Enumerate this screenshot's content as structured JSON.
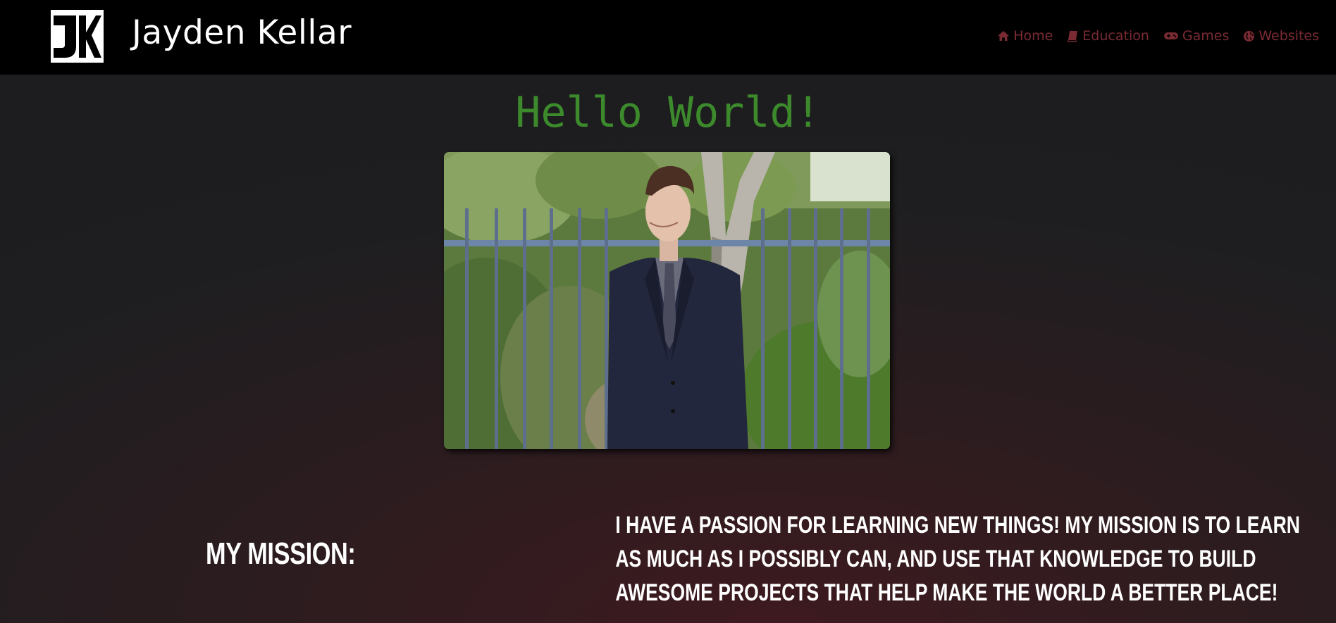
{
  "header": {
    "brand": "Jayden Kellar",
    "logo_text": "JK"
  },
  "nav": {
    "items": [
      {
        "label": "Home",
        "icon": "home-icon"
      },
      {
        "label": "Education",
        "icon": "book-icon"
      },
      {
        "label": "Games",
        "icon": "gamepad-icon"
      },
      {
        "label": "Websites",
        "icon": "globe-icon"
      }
    ]
  },
  "hero": {
    "greeting": "Hello World!"
  },
  "mission": {
    "label": "MY MISSION:",
    "lines": [
      "I HAVE A PASSION FOR LEARNING NEW THINGS! MY MISSION IS TO LEARN",
      "AS MUCH AS I POSSIBLY CAN, AND USE THAT KNOWLEDGE TO BUILD",
      "AWESOME PROJECTS THAT HELP MAKE THE WORLD A BETTER PLACE!"
    ]
  },
  "colors": {
    "nav_link": "#7a2a32",
    "greeting": "#3c8a2c",
    "header_bg": "#000000"
  }
}
